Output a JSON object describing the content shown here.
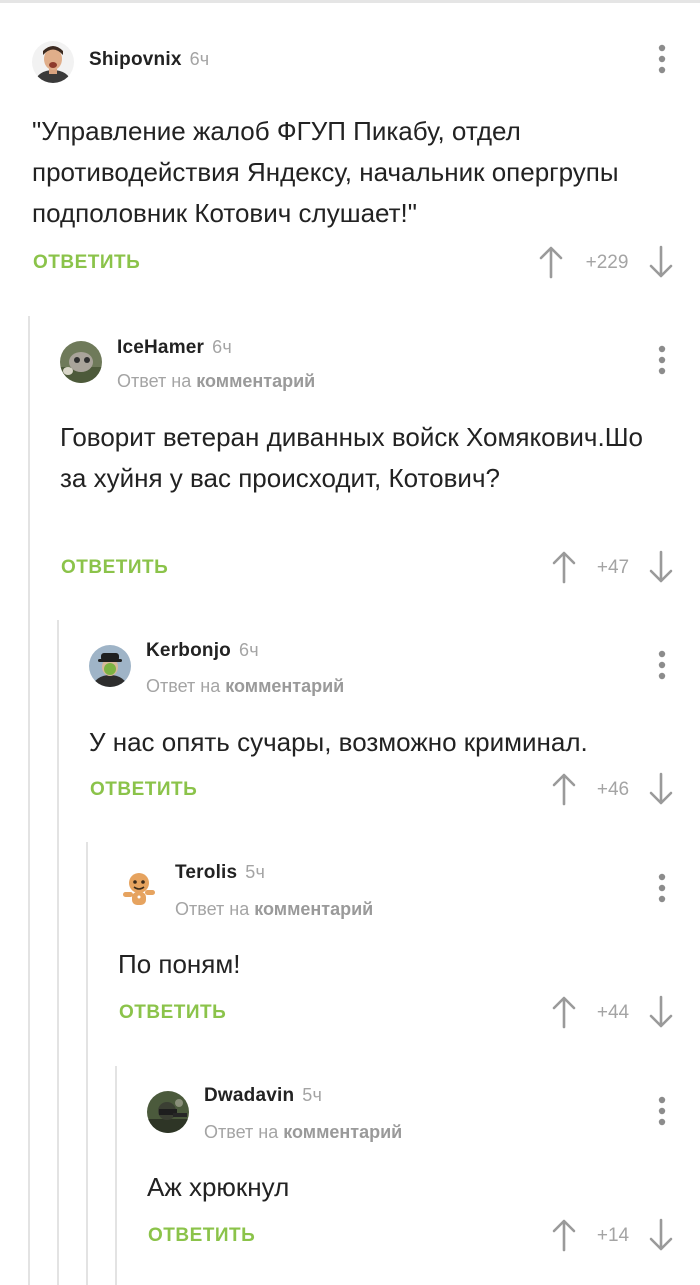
{
  "reply_label": "ОТВЕТИТЬ",
  "reply_prefix": "Ответ на",
  "reply_target": "комментарий",
  "accent_color": "#8bc34a",
  "comments": [
    {
      "author": "Shipovnix",
      "age": "6ч",
      "text": "\"Управление жалоб ФГУП Пикабу, отдел противодействия Яндексу, начальник опергрупы подполовник Котович слушает!\"",
      "rating": "+229",
      "avatar_icon": "user-avatar-icon"
    },
    {
      "author": "IceHamer",
      "age": "6ч",
      "text": "Говорит ветеран диванных войск Хомякович.Шо за хуйня у вас происходит, Котович?",
      "rating": "+47",
      "avatar_icon": "user-avatar-icon"
    },
    {
      "author": "Kerbonjo",
      "age": "6ч",
      "text": "У нас опять сучары, возможно криминал.",
      "rating": "+46",
      "avatar_icon": "user-avatar-icon"
    },
    {
      "author": "Terolis",
      "age": "5ч",
      "text": "По поням!",
      "rating": "+44",
      "avatar_icon": "user-avatar-icon"
    },
    {
      "author": "Dwadavin",
      "age": "5ч",
      "text": "Аж хрюкнул",
      "rating": "+14",
      "avatar_icon": "user-avatar-icon"
    }
  ]
}
